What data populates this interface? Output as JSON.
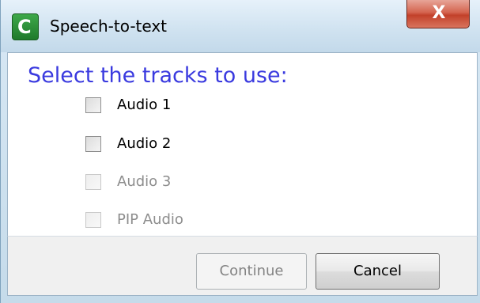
{
  "window": {
    "title": "Speech-to-text",
    "app_icon": "camtasia-icon",
    "close_glyph": "X"
  },
  "dialog": {
    "heading": "Select the tracks to use:",
    "options": [
      {
        "label": "Audio 1",
        "checked": false,
        "enabled": true
      },
      {
        "label": "Audio 2",
        "checked": false,
        "enabled": true
      },
      {
        "label": "Audio 3",
        "checked": false,
        "enabled": false
      },
      {
        "label": "PIP Audio",
        "checked": false,
        "enabled": false
      }
    ]
  },
  "buttons": {
    "continue_label": "Continue",
    "continue_enabled": false,
    "cancel_label": "Cancel"
  },
  "colors": {
    "heading": "#3a3adf",
    "disabled_text": "#8d8d8d",
    "titlebar": "#cfe2f0",
    "close_button": "#c2412a"
  }
}
